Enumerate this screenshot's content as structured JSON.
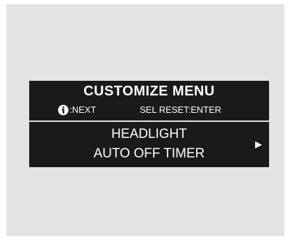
{
  "display": {
    "title": "CUSTOMIZE MENU",
    "hint_next": ":NEXT",
    "hint_sel": "SEL RESET:ENTER",
    "item_line1": "HEADLIGHT",
    "item_line2": "AUTO OFF TIMER",
    "icons": {
      "info": "info-icon",
      "arrow": "play-arrow-icon"
    },
    "colors": {
      "background": "#1a1a1a",
      "text": "#ffffff",
      "frame": "#e4e4e4"
    }
  }
}
